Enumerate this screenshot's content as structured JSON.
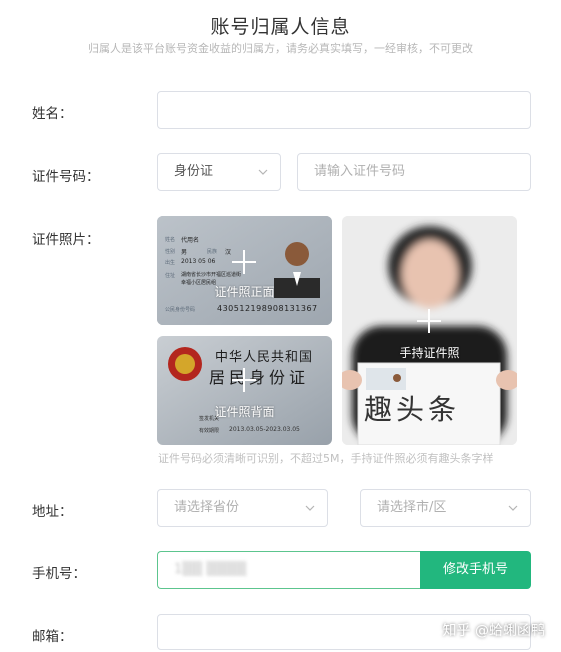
{
  "header": {
    "title": "账号归属人信息",
    "subtitle": "归属人是该平台账号资金收益的归属方，请务必真实填写，一经审核，不可更改"
  },
  "form": {
    "name": {
      "label": "姓名：",
      "value": ""
    },
    "id_number": {
      "label": "证件号码：",
      "type_value": "身份证",
      "placeholder": "请输入证件号码"
    },
    "id_photos": {
      "label": "证件照片：",
      "front_label": "证件照正面",
      "back_label": "证件照背面",
      "hand_label": "手持证件照",
      "hint": "证件号码必须清晰可识别，不超过5M，手持证件照必须有趣头条字样",
      "front_card": {
        "name_key": "姓名",
        "name_val": "代用名",
        "sex_key": "性别",
        "sex_val": "男",
        "nation_key": "民族",
        "nation_val": "汉",
        "birth_key": "出生",
        "birth_val": "2013  05  06",
        "addr_key": "住址",
        "addr_val_1": "湖南省长沙市开福区巡道街",
        "addr_val_2": "幸福小区居民组",
        "id_key": "公民身份号码",
        "id_val": "430512198908131367"
      },
      "back_card": {
        "country": "中华人民共和国",
        "doc": "居民身份证",
        "issuer_key": "签发机关",
        "validity_key": "有效期限",
        "validity_val": "2013.03.05-2023.03.05"
      },
      "hand_sign_text": "趣头条"
    },
    "address": {
      "label": "地址：",
      "province_placeholder": "请选择省份",
      "city_placeholder": "请选择市/区"
    },
    "phone": {
      "label": "手机号：",
      "value": "1▒▒ ▒▒▒▒",
      "button": "修改手机号"
    },
    "email": {
      "label": "邮箱：",
      "value": ""
    }
  },
  "watermark": "知乎 @蛤蜊函鸭",
  "colors": {
    "accent": "#22b77e",
    "border": "#dcdfe6",
    "focus_border": "#5cc58e"
  }
}
